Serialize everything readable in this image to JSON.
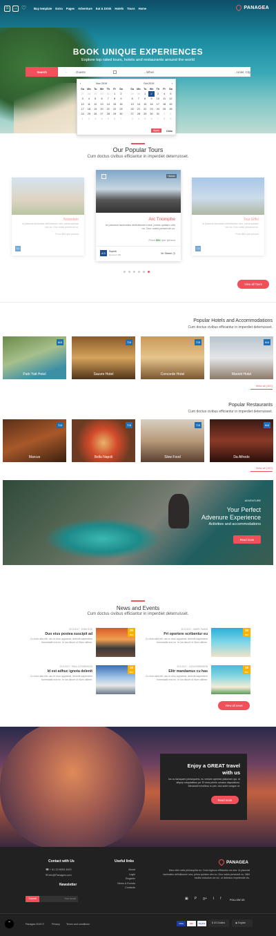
{
  "nav": {
    "menu": [
      "Buy template",
      "Extra",
      "Pages",
      "Adventure",
      "Eat & Drink",
      "Hotels",
      "Tours",
      "Home"
    ],
    "logo": "PANAGEA"
  },
  "hero": {
    "title": "BOOK UNIQUE EXPERIENCES",
    "subtitle": "Explore top rated tours, hotels and restaurants around the world"
  },
  "search": {
    "button": "Search",
    "guests": "Guests",
    "date": "...When",
    "city": "...Hotel, City"
  },
  "calendar": {
    "month_left": "Nov 2019",
    "month_right": "Oct 2019",
    "days": [
      "Su",
      "Mo",
      "Tu",
      "We",
      "Th",
      "Fr",
      "Sa"
    ],
    "left": [
      [
        "27",
        "28",
        "29",
        "30",
        "31",
        "1",
        "2"
      ],
      [
        "3",
        "4",
        "5",
        "6",
        "7",
        "8",
        "9"
      ],
      [
        "10",
        "11",
        "12",
        "13",
        "14",
        "15",
        "16"
      ],
      [
        "17",
        "18",
        "19",
        "20",
        "21",
        "22",
        "23"
      ],
      [
        "24",
        "25",
        "26",
        "27",
        "28",
        "29",
        "30"
      ],
      [
        "1",
        "2",
        "3",
        "4",
        "5",
        "6",
        "7"
      ]
    ],
    "right": [
      [
        "29",
        "30",
        "1",
        "2",
        "3",
        "4",
        "5"
      ],
      [
        "6",
        "7",
        "8",
        "9",
        "10",
        "11",
        "12"
      ],
      [
        "13",
        "14",
        "15",
        "16",
        "17",
        "18",
        "19"
      ],
      [
        "20",
        "21",
        "22",
        "23",
        "24",
        "25",
        "26"
      ],
      [
        "27",
        "28",
        "29",
        "30",
        "31",
        "1",
        "2"
      ],
      [
        "3",
        "4",
        "5",
        "6",
        "7",
        "8",
        "9"
      ]
    ],
    "selected": "2",
    "apply": "Apply",
    "clear": "Clear"
  },
  "tours": {
    "title": "Our Popular Tours",
    "subtitle": "Cum doctus civibus efficiantur in imperdiet deterruisset.",
    "cards": [
      {
        "name": "Notredam",
        "text": "Id placerat tacimates definitionem sea, prima quidam vim no. Duo nobis persecuti cu.",
        "price": "From $54 /per person",
        "score": "9.0",
        "rating": "Superb",
        "reviews": "350 Reviews",
        "tag": "Historic"
      },
      {
        "name": "Arc Triomphe",
        "text": "Id placerat tacimates definitionem sea, prima quidam vim no. Duo nobis persecuti cu.",
        "price_from": "From",
        "price": "$54",
        "per": "/per person",
        "score": "8.5",
        "rating": "Superb",
        "reviews": "Reviews 350",
        "duration": "1h 30min",
        "tag": "Historic"
      },
      {
        "name": "Tour Eiffel",
        "text": "Id placerat tacimates definitionem sea, prima quidam vim no. Duo nobis persecuti cu.",
        "price": "From $54 /per person",
        "score": "7.5",
        "rating": "Good",
        "reviews": "350 Reviews",
        "tag": "Historic"
      }
    ],
    "view_all": "View all Tours"
  },
  "hotels": {
    "title": "Popular Hotels and Accommodations",
    "subtitle": "Cum doctus civibus efficiantur in imperdiet deterruisset.",
    "items": [
      {
        "name": "Park Yatt Hotel",
        "score": "8.9"
      },
      {
        "name": "Sauvre Hotel",
        "score": "7.0"
      },
      {
        "name": "Concorde Hotel",
        "score": "7.5"
      },
      {
        "name": "Mariott Hotel",
        "score": "9.0"
      }
    ],
    "view_all": "View all (157)"
  },
  "restaurants": {
    "title": "Popular Restaurants",
    "subtitle": "Cum doctus civibus efficiantur in imperdiet deterruisset.",
    "items": [
      {
        "name": "Marcus",
        "score": "7.0"
      },
      {
        "name": "Bella Napoli",
        "score": "7.5"
      },
      {
        "name": "Slow Food",
        "score": "7.5"
      },
      {
        "name": "Da Alfredo",
        "score": "9.0"
      }
    ],
    "view_all": "View all (157)"
  },
  "adventure": {
    "tag": "ADVENTURE",
    "title1": "Your Perfect",
    "title2": "Advenure Experience",
    "subtitle": "Activities and accommodations",
    "button": "Read more"
  },
  "news": {
    "title": "News and Events",
    "subtitle": "Cum doctus civibus efficiantur in imperdiet deterruisset.",
    "items": [
      {
        "meta": "20.5.2017 · ENIM SOS",
        "title": "Duo eius postea suscipit ad",
        "text": "Cu eum alia elit, usu in eius appareat, deleniti sapientem honestatis eos ex. In ius dicunt ut illum utilime.",
        "day": "28",
        "mon": "Dec"
      },
      {
        "meta": "20.5.2017 · MARK TWAIN",
        "title": "Pri oportere scribentur eu",
        "text": "Cu eum alia elit, usu in eius appareat, deleniti sapientem honestatis eos ex. In ius dicunt ut illum utilime.",
        "day": "28",
        "mon": "Dec"
      },
      {
        "meta": "20.5.2017 · PAUL & ROBINSON",
        "title": "Id est adhuc ignota delenit",
        "text": "Cu eum alia elit, usu in eius appareat, deleniti sapientem honestatis eos ex. In ius dicunt ut illum utilime.",
        "day": "28",
        "mon": "Dec"
      },
      {
        "meta": "20.5.2017 · LUCA ROBINSON",
        "title": "Elitr mandamus cu has",
        "text": "Cu eum alia elit, usu in eius appareat, deleniti sapientem honestatis eos ex. In ius dicunt ut illum utilime.",
        "day": "28",
        "mon": "Dec"
      }
    ],
    "view_all": "View all news"
  },
  "cta": {
    "title1": "Enjoy a GREAT travel",
    "title2": "with us",
    "text": "Ius cu tamquam persequeris, eu veniam apeirian platonem qui, id aliquip voluptatibus pri. Ei mea primis ornatus disputationi. Menandri erroribus cu per, duo solet congue ut.",
    "button": "Read more"
  },
  "footer": {
    "contact_title": "Contact with Us",
    "phone": "+ 61 23 8093 3400",
    "email": "info@Panagea.com",
    "newsletter": "Newsletter",
    "submit": "Submit",
    "email_ph": "Your email",
    "links_title": "Useful links",
    "links": [
      "About",
      "Login",
      "Register",
      "News & Events",
      "Contacts"
    ],
    "logo": "PANAGEA",
    "about": "Mea nibh meis philosophia eu. Duis legimus efficiantur ea sea. Id placerat tacimates definitionem sea, prima quidam vim no. Duo nobis persecuti cu. Nihil facilisi indoctum an vix, ut delectus expetendis vis.",
    "follow": "FOLLOW US",
    "copyright": "Panagea 2019 ©",
    "privacy": "Privacy",
    "terms": "Terms and conditions",
    "currency": "US Dollars",
    "language": "English",
    "payments": [
      "VISA",
      "MC",
      "PayPal"
    ]
  },
  "colors": {
    "accent": "#f0505a",
    "score": "#1d6fb8",
    "date": "#f9b200",
    "footer": "#212121"
  }
}
